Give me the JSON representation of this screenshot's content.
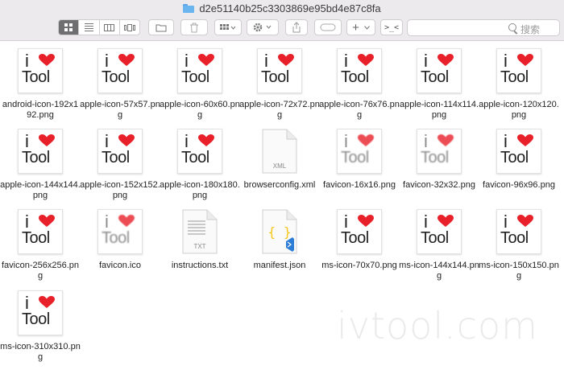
{
  "window": {
    "title": "d2e51140b25c3303869e95bd4e87c8fa"
  },
  "toolbar": {
    "search_placeholder": "搜索",
    "action_symbol": "+",
    "terminal_symbol": ">_<"
  },
  "files": [
    {
      "name": "android-icon-192x192.png",
      "type": "logo"
    },
    {
      "name": "apple-icon-57x57.png",
      "type": "logo"
    },
    {
      "name": "apple-icon-60x60.png",
      "type": "logo"
    },
    {
      "name": "apple-icon-72x72.png",
      "type": "logo"
    },
    {
      "name": "apple-icon-76x76.png",
      "type": "logo"
    },
    {
      "name": "apple-icon-114x114.png",
      "type": "logo"
    },
    {
      "name": "apple-icon-120x120.png",
      "type": "logo"
    },
    {
      "name": "apple-icon-144x144.png",
      "type": "logo"
    },
    {
      "name": "apple-icon-152x152.png",
      "type": "logo"
    },
    {
      "name": "apple-icon-180x180.png",
      "type": "logo"
    },
    {
      "name": "browserconfig.xml",
      "type": "xml",
      "doc_label": "XML"
    },
    {
      "name": "favicon-16x16.png",
      "type": "logo-blur"
    },
    {
      "name": "favicon-32x32.png",
      "type": "logo-blur"
    },
    {
      "name": "favicon-96x96.png",
      "type": "logo"
    },
    {
      "name": "favicon-256x256.png",
      "type": "logo"
    },
    {
      "name": "favicon.ico",
      "type": "logo-blur"
    },
    {
      "name": "instructions.txt",
      "type": "txt",
      "doc_label": "TXT"
    },
    {
      "name": "manifest.json",
      "type": "json",
      "doc_label": "{ }"
    },
    {
      "name": "ms-icon-70x70.png",
      "type": "logo"
    },
    {
      "name": "ms-icon-144x144.png",
      "type": "logo"
    },
    {
      "name": "ms-icon-150x150.png",
      "type": "logo"
    },
    {
      "name": "ms-icon-310x310.png",
      "type": "logo"
    }
  ],
  "logo": {
    "letter": "i",
    "word": "Tool",
    "heart_color": "#e8202a"
  },
  "watermark": "ivtool.com",
  "colors": {
    "folder": "#6ab4f0",
    "toolbar_bg": "#eceaec",
    "active_view": "#6f6e70",
    "vscode_blue": "#2d7cd6",
    "json_yellow": "#f5c518"
  }
}
